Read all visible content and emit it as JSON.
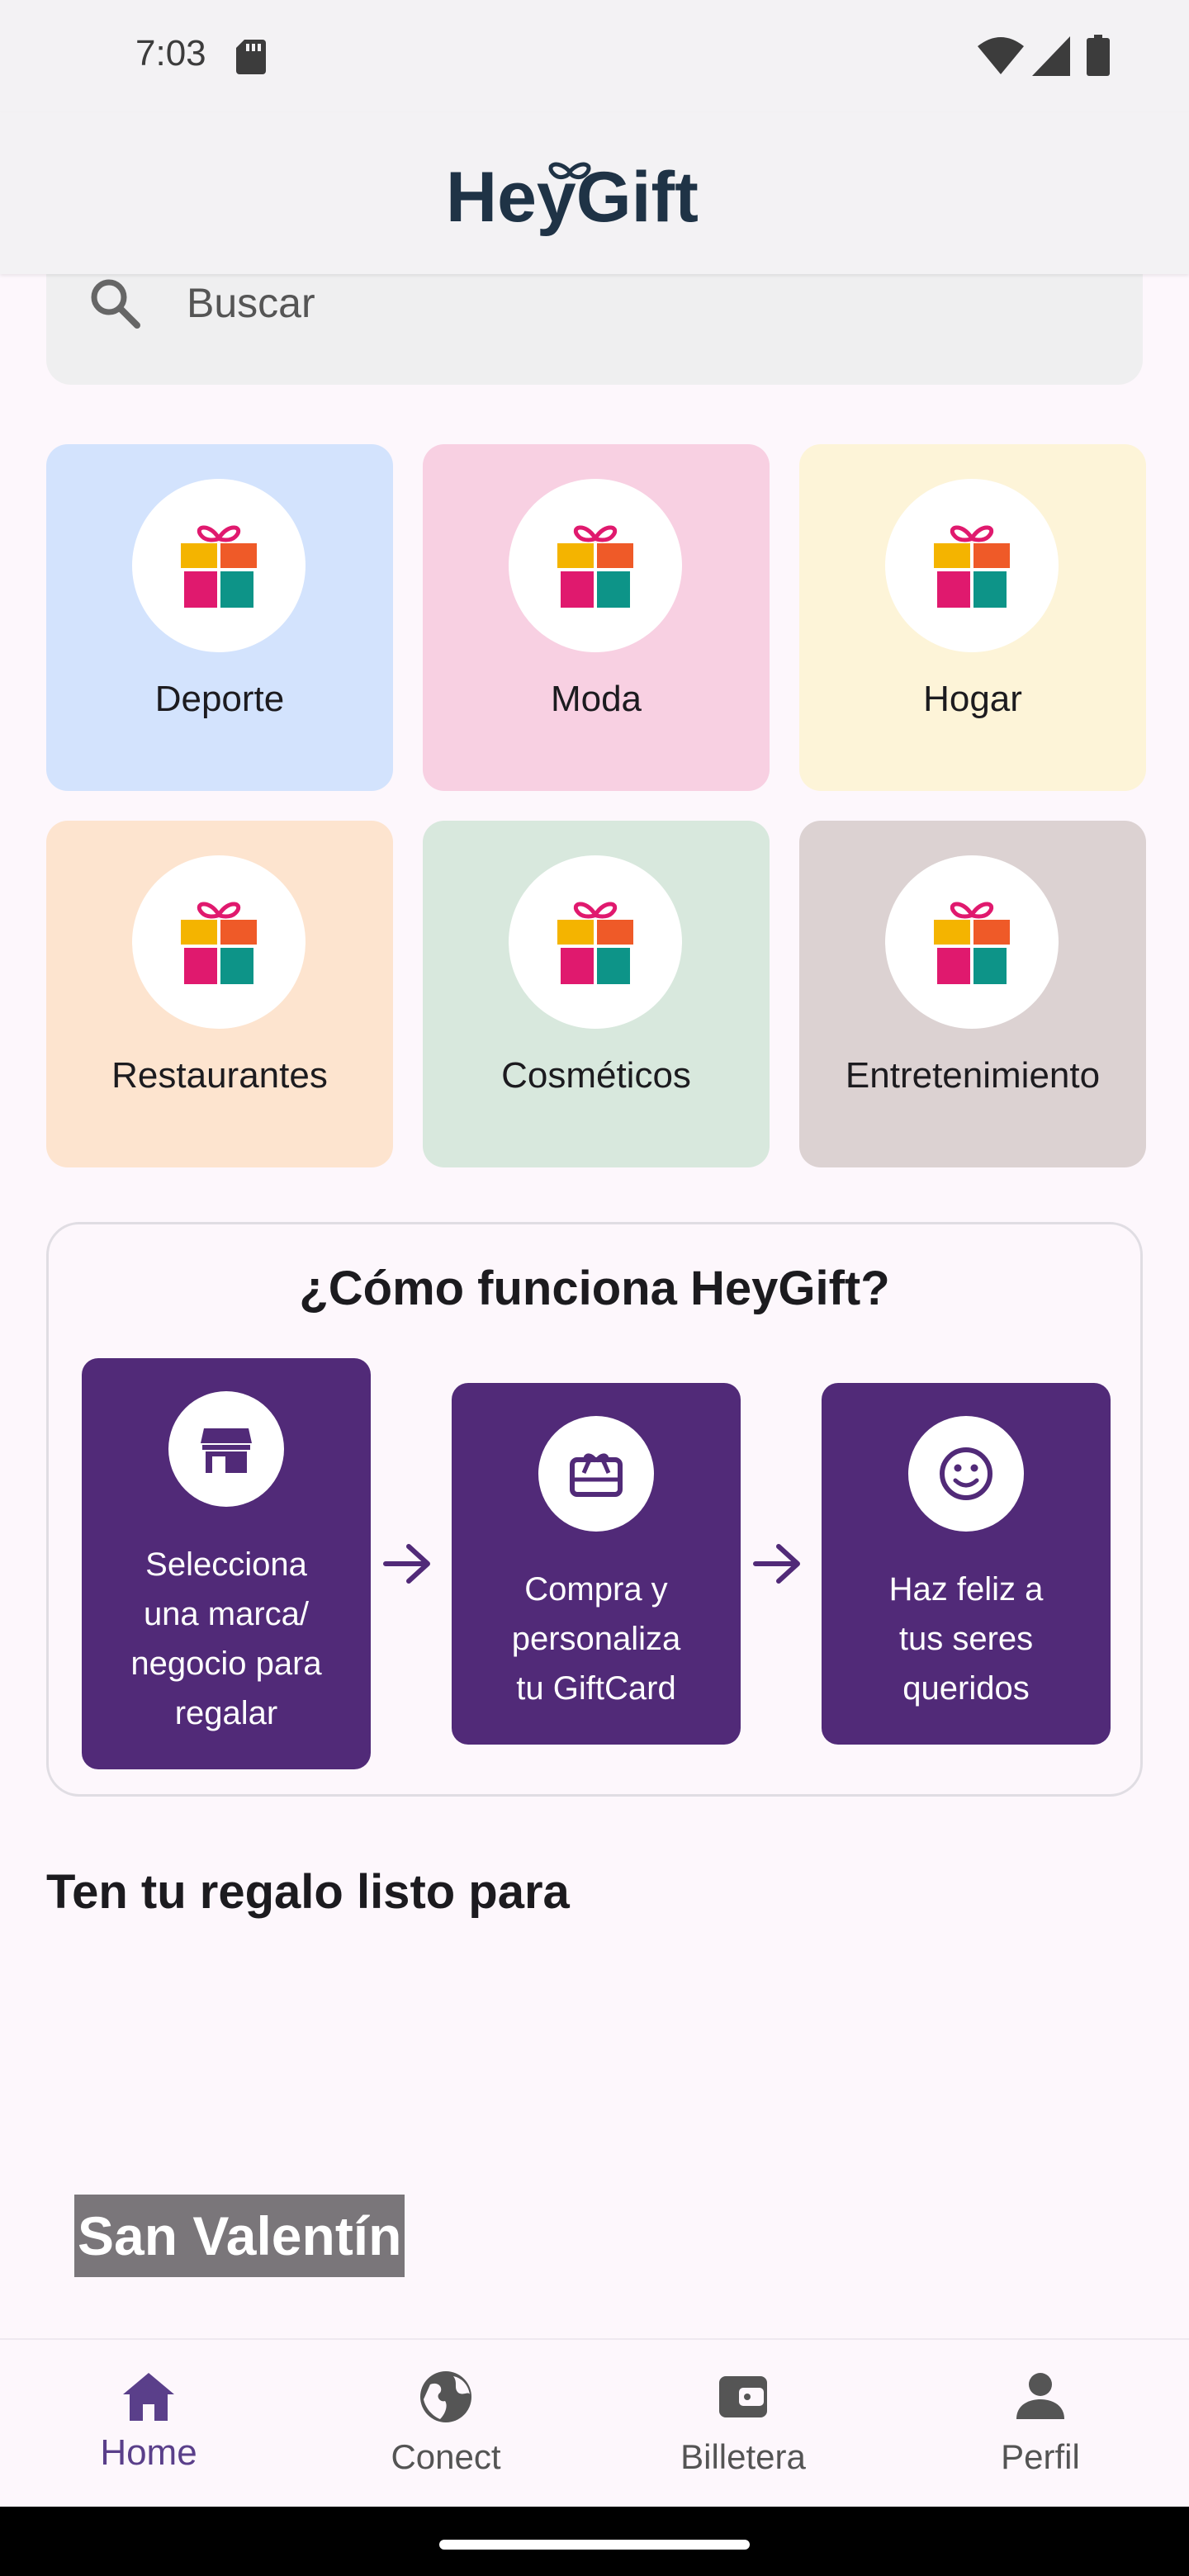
{
  "status_bar": {
    "time": "7:03"
  },
  "header": {
    "logo_text": "HeyGift"
  },
  "search": {
    "placeholder": "Buscar"
  },
  "categories": [
    {
      "label": "Deporte",
      "color": "#d3e3fd"
    },
    {
      "label": "Moda",
      "color": "#f8d0e2"
    },
    {
      "label": "Hogar",
      "color": "#fdf4d8"
    },
    {
      "label": "Restaurantes",
      "color": "#fde4cf"
    },
    {
      "label": "Cosméticos",
      "color": "#d8e8dd"
    },
    {
      "label": "Entretenimiento",
      "color": "#dcd2d2"
    }
  ],
  "how_it_works": {
    "title": "¿Cómo funciona HeyGift?",
    "steps": [
      {
        "text": "Selecciona\nuna marca/\nnegocio para\nregalar",
        "icon": "storefront-icon"
      },
      {
        "text": "Compra y\npersonaliza\ntu GiftCard",
        "icon": "gift-card-icon"
      },
      {
        "text": "Haz feliz a\ntus seres\nqueridos",
        "icon": "smiley-icon"
      }
    ]
  },
  "section": {
    "title": "Ten tu regalo listo para",
    "banner_label": "San Valentín"
  },
  "bottom_nav": {
    "items": [
      {
        "label": "Home",
        "icon": "home-icon",
        "active": true
      },
      {
        "label": "Conect",
        "icon": "globe-icon",
        "active": false
      },
      {
        "label": "Billetera",
        "icon": "wallet-icon",
        "active": false
      },
      {
        "label": "Perfil",
        "icon": "person-icon",
        "active": false
      }
    ]
  },
  "colors": {
    "brand_purple": "#512a78",
    "logo_dark": "#1f3346",
    "nav_active": "#5a3f8a"
  }
}
